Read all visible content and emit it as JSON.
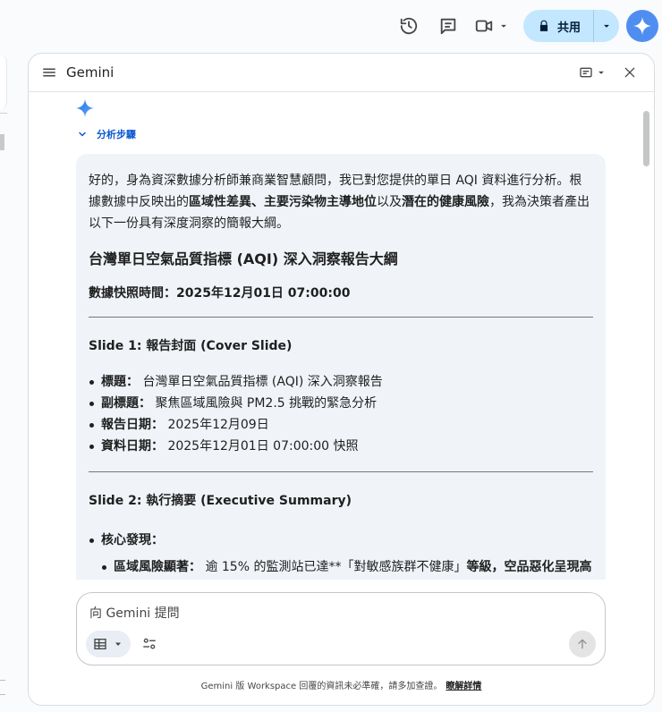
{
  "toolbar": {
    "share_label": "共用"
  },
  "panel": {
    "title": "Gemini",
    "steps_label": "分析步驟"
  },
  "response": {
    "intro_1": "好的，身為資深數據分析師兼商業智慧顧問，我已對您提供的單日 AQI 資料進行分析。根據數據中反映出的",
    "intro_b1": "區域性差異、主要污染物主導地位",
    "intro_2": "以及",
    "intro_b2": "潛在的健康風險",
    "intro_3": "，我為決策者產出以下一份具有深度洞察的簡報大綱。",
    "title": "台灣單日空氣品質指標 (AQI) 深入洞察報告大綱",
    "snapshot": "數據快照時間：2025年12月01日 07:00:00",
    "slide1": {
      "title": "Slide 1: 報告封面 (Cover Slide)",
      "items": [
        {
          "label": "標題：",
          "value": " 台灣單日空氣品質指標 (AQI) 深入洞察報告"
        },
        {
          "label": "副標題：",
          "value": " 聚焦區域風險與 PM2.5 挑戰的緊急分析"
        },
        {
          "label": "報告日期：",
          "value": " 2025年12月09日"
        },
        {
          "label": "資料日期：",
          "value": " 2025年12月01日 07:00:00 快照"
        }
      ]
    },
    "slide2": {
      "title": "Slide 2: 執行摘要 (Executive Summary)",
      "core_label": "核心發現：",
      "sub_label": "區域風險顯著：",
      "sub_text": " 逾 15% 的監測站已達**「對敏感族群不健康」",
      "sub_bold": "等級，空品惡化呈現高"
    }
  },
  "input": {
    "placeholder": "向 Gemini 提問"
  },
  "footer": {
    "text": "Gemini 版 Workspace 回覆的資訊未必準確，請多加查證。",
    "link": "瞭解詳情"
  },
  "colors": {
    "accent": "#0b57d0",
    "share_bg": "#c2e7ff",
    "response_bg": "#f0f4f9"
  }
}
